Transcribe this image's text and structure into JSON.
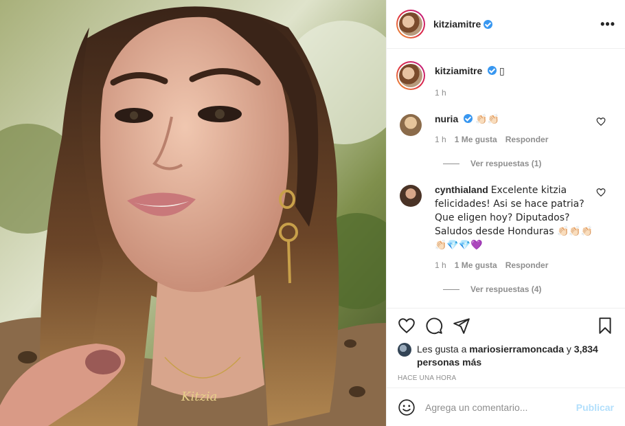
{
  "header": {
    "username": "kitziamitre",
    "more_icon": "more-options-icon",
    "more_label": "•••"
  },
  "caption": {
    "username": "kitziamitre",
    "text": "▯",
    "time": "1 h"
  },
  "comments": [
    {
      "username": "nuria",
      "text": "👏🏻👏🏻",
      "time": "1 h",
      "likes": "1 Me gusta",
      "reply": "Responder",
      "view_replies": "Ver respuestas (1)",
      "avatar_color": "#c9a77c"
    },
    {
      "username": "cynthialand",
      "text": "Excelente kitzia felicidades! Asi se hace patria? Que eligen hoy? Diputados? Saludos desde Honduras 👏🏻👏🏻👏🏻 👏🏻💎💎💜",
      "time": "1 h",
      "likes": "1 Me gusta",
      "reply": "Responder",
      "view_replies": "Ver respuestas (4)",
      "avatar_color": "#6b4a3a"
    }
  ],
  "likes": {
    "prefix": "Les gusta a",
    "user": "mariosierramoncada",
    "joiner": "y",
    "others": "3,834 personas más"
  },
  "time_ago": "HACE UNA HORA",
  "add_comment": {
    "placeholder": "Agrega un comentario...",
    "publish": "Publicar"
  },
  "photo": {
    "necklace_text": "Kitzia"
  },
  "colors": {
    "verified": "#3897f0",
    "publish_disabled": "#b2dffc",
    "secondary_text": "#8e8e8e"
  }
}
